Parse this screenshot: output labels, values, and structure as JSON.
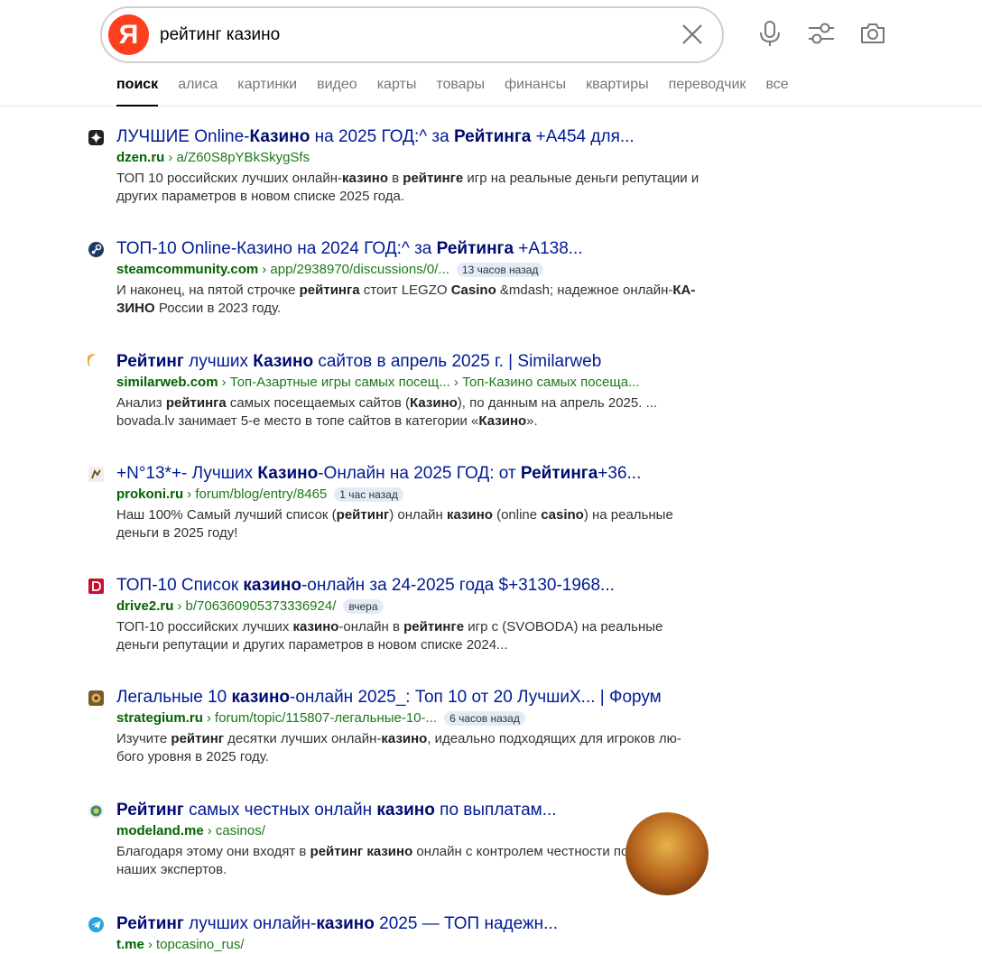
{
  "search": {
    "logo_letter": "Я",
    "query": "рейтинг казино"
  },
  "tabs": [
    {
      "label": "поиск",
      "active": true
    },
    {
      "label": "алиса"
    },
    {
      "label": "картинки"
    },
    {
      "label": "видео"
    },
    {
      "label": "карты"
    },
    {
      "label": "товары"
    },
    {
      "label": "финансы"
    },
    {
      "label": "квартиры"
    },
    {
      "label": "переводчик"
    },
    {
      "label": "все"
    }
  ],
  "results": [
    {
      "title_parts": [
        [
          "ЛУЧШИЕ Online-",
          false
        ],
        [
          "Казино",
          true
        ],
        [
          " на 2025 ГОД:^ за ",
          false
        ],
        [
          "Рейтинга",
          true
        ],
        [
          " +A454 для...",
          false
        ]
      ],
      "domain": "dzen.ru",
      "path": "› a/Z60S8pYBkSkygSfs",
      "badge": "",
      "snippet_parts": [
        [
          "ТОП 10 российских лучших онлайн-",
          false
        ],
        [
          "казино",
          true
        ],
        [
          " в ",
          false
        ],
        [
          "рейтинге",
          true
        ],
        [
          " игр на реальные деньги репутации и других параметров в новом списке 2025 года.",
          false
        ]
      ],
      "icon": "dzen-icon",
      "icon_color": "#222222"
    },
    {
      "title_parts": [
        [
          "ТОП-10 Online-Казино на 2024 ГОД:^ за ",
          false
        ],
        [
          "Рейтинга",
          true
        ],
        [
          " +A138...",
          false
        ]
      ],
      "domain": "steamcommunity.com",
      "path": "› app/2938970/discussions/0/...",
      "badge": "13 часов назад",
      "snippet_parts": [
        [
          "И наконец, на пятой строчке ",
          false
        ],
        [
          "рейтинга",
          true
        ],
        [
          " стоит LEGZO ",
          false
        ],
        [
          "Casino",
          true
        ],
        [
          " &mdash; надежное онлайн-",
          false
        ],
        [
          "КА-ЗИНО",
          true
        ],
        [
          " России в 2023 году.",
          false
        ]
      ],
      "icon": "steam-icon",
      "icon_color": "#1b3a66"
    },
    {
      "title_parts": [
        [
          "Рейтинг",
          true
        ],
        [
          " лучших ",
          false
        ],
        [
          "Казино",
          true
        ],
        [
          " сайтов в апрель 2025 г. | Similarweb",
          false
        ]
      ],
      "domain": "similarweb.com",
      "path": "› Топ-Азартные игры самых посещ... › Топ-Казино самых посеща...",
      "badge": "",
      "snippet_parts": [
        [
          "Анализ ",
          false
        ],
        [
          "рейтинга",
          true
        ],
        [
          " самых посещаемых сайтов (",
          false
        ],
        [
          "Казино",
          true
        ],
        [
          "), по данным на апрель 2025. ... bovada.lv занимает 5-е место в топе сайтов в категории «",
          false
        ],
        [
          "Казино",
          true
        ],
        [
          "».",
          false
        ]
      ],
      "icon": "similarweb-icon",
      "icon_color": "#1d3f8a"
    },
    {
      "title_parts": [
        [
          "+N°13*+- Лучших ",
          false
        ],
        [
          "Казино",
          true
        ],
        [
          "-Онлайн на 2025 ГОД: от ",
          false
        ],
        [
          "Рейтинга",
          true
        ],
        [
          "+36...",
          false
        ]
      ],
      "domain": "prokoni.ru",
      "path": "› forum/blog/entry/8465",
      "badge": "1 час назад",
      "snippet_parts": [
        [
          "Наш 100% Самый лучший список (",
          false
        ],
        [
          "рейтинг",
          true
        ],
        [
          ") онлайн ",
          false
        ],
        [
          "казино",
          true
        ],
        [
          " (online ",
          false
        ],
        [
          "casino",
          true
        ],
        [
          ") на реальные деньги в 2025 году!",
          false
        ]
      ],
      "icon": "prokoni-icon",
      "icon_color": "#6b4a1a"
    },
    {
      "title_parts": [
        [
          "ТОП-10 Список ",
          false
        ],
        [
          "казино",
          true
        ],
        [
          "-онлайн за 24-2025 года $+3130-1968...",
          false
        ]
      ],
      "domain": "drive2.ru",
      "path": "› b/706360905373336924/",
      "badge": "вчера",
      "snippet_parts": [
        [
          "ТОП-10 российских лучших ",
          false
        ],
        [
          "казино",
          true
        ],
        [
          "-онлайн в ",
          false
        ],
        [
          "рейтинге",
          true
        ],
        [
          " игр с (SVOBODA) на реальные деньги репутации и других параметров в новом списке 2024...",
          false
        ]
      ],
      "icon": "drive2-icon",
      "icon_color": "#c8102e"
    },
    {
      "title_parts": [
        [
          "Легальные 10 ",
          false
        ],
        [
          "казино",
          true
        ],
        [
          "-онлайн 2025_: Топ 10 от 20 ЛучшиХ... | Форум",
          false
        ]
      ],
      "domain": "strategium.ru",
      "path": "› forum/topic/115807-легальные-10-...",
      "badge": "6 часов назад",
      "snippet_parts": [
        [
          "Изучите ",
          false
        ],
        [
          "рейтинг",
          true
        ],
        [
          " десятки лучших онлайн-",
          false
        ],
        [
          "казино",
          true
        ],
        [
          ", идеально подходящих для игроков лю-бого уровня в 2025 году.",
          false
        ]
      ],
      "icon": "strategium-icon",
      "icon_color": "#7a5a2a"
    },
    {
      "title_parts": [
        [
          "Рейтинг",
          true
        ],
        [
          " самых честных онлайн ",
          false
        ],
        [
          "казино",
          true
        ],
        [
          " по выплатам...",
          false
        ]
      ],
      "domain": "modeland.me",
      "path": "› casinos/",
      "badge": "",
      "snippet_parts": [
        [
          "Благодаря этому они входят в ",
          false
        ],
        [
          "рейтинг казино",
          true
        ],
        [
          " онлайн с контролем честности по версии наших экспертов.",
          false
        ]
      ],
      "icon": "modeland-icon",
      "icon_color": "#3a8a7a"
    },
    {
      "title_parts": [
        [
          "Рейтинг",
          true
        ],
        [
          " лучших онлайн-",
          false
        ],
        [
          "казино",
          true
        ],
        [
          " 2025 — ТОП надежн...",
          false
        ]
      ],
      "domain": "t.me",
      "path": "› topcasino_rus/",
      "badge": "",
      "snippet_parts": [],
      "icon": "telegram-icon",
      "icon_color": "#2aa3df"
    }
  ]
}
